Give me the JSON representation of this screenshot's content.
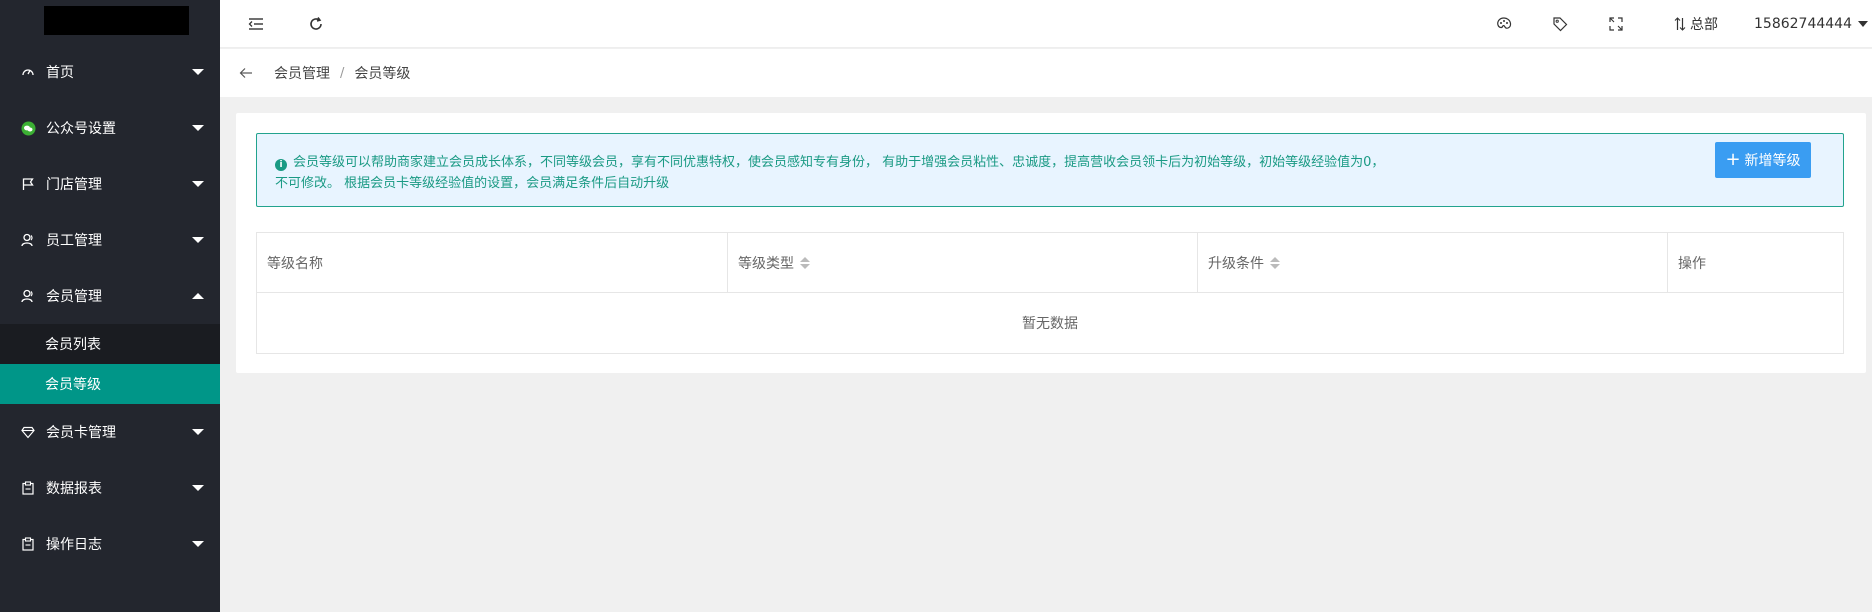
{
  "sidebar": {
    "items": [
      {
        "label": "首页",
        "icon": "dashboard-icon"
      },
      {
        "label": "公众号设置",
        "icon": "wechat-icon"
      },
      {
        "label": "门店管理",
        "icon": "flag-icon"
      },
      {
        "label": "员工管理",
        "icon": "user-icon"
      },
      {
        "label": "会员管理",
        "icon": "user-icon"
      },
      {
        "label": "会员卡管理",
        "icon": "diamond-icon"
      },
      {
        "label": "数据报表",
        "icon": "clipboard-icon"
      },
      {
        "label": "操作日志",
        "icon": "clipboard-icon"
      }
    ],
    "submenu": [
      {
        "label": "会员列表"
      },
      {
        "label": "会员等级",
        "active": true
      }
    ],
    "active_color": "#009688",
    "background": "#23262e"
  },
  "header": {
    "store_label": "总部",
    "phone": "15862744444"
  },
  "breadcrumb": {
    "items": [
      "会员管理",
      "会员等级"
    ],
    "separator": "/"
  },
  "notice": {
    "text": "会员等级可以帮助商家建立会员成长体系，不同等级会员，享有不同优惠特权，使会员感知专有身份， 有助于增强会员粘性、忠诚度，提高营收会员领卡后为初始等级，初始等级经验值为0，不可修改。 根据会员卡等级经验值的设置，会员满足条件后自动升级",
    "button_label": "新增等级",
    "button_color": "#3a9df2"
  },
  "table": {
    "columns": [
      "等级名称",
      "等级类型",
      "升级条件",
      "操作"
    ],
    "empty_text": "暂无数据"
  }
}
